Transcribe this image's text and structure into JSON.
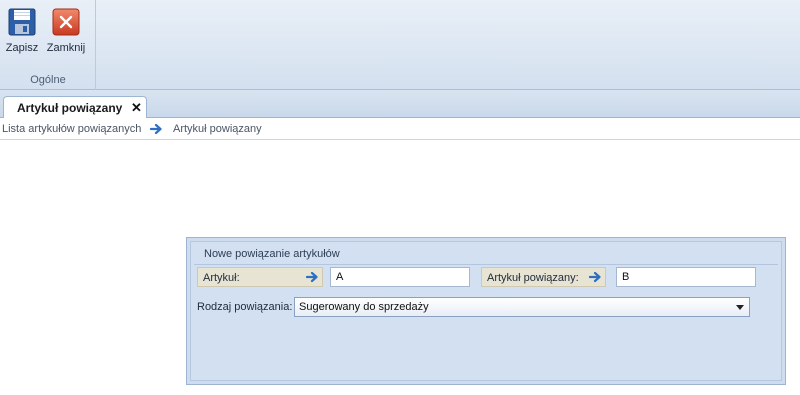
{
  "ribbon": {
    "save_label": "Zapisz",
    "close_label": "Zamknij",
    "group_label": "Ogólne"
  },
  "tab": {
    "title": "Artykuł powiązany",
    "close_glyph": "✕"
  },
  "breadcrumb": {
    "parent": "Lista artykułów powiązanych",
    "current": "Artykuł powiązany"
  },
  "panel": {
    "title": "Nowe powiązanie artykułów",
    "article_label": "Artykuł:",
    "article_value": "A",
    "related_label": "Artykuł powiązany:",
    "related_value": "B",
    "type_label": "Rodzaj powiązania:",
    "type_value": "Sugerowany do sprzedaży"
  },
  "icons": {
    "save": "floppy-disk-icon",
    "close": "close-x-icon",
    "arrow": "arrow-right-icon"
  },
  "colors": {
    "ribbon_bg": "#dde7f3",
    "panel_bg": "#d3e0f1",
    "arrow_blue": "#2f6fc2",
    "close_red": "#d9452b",
    "label_box": "#e8e4d4"
  }
}
